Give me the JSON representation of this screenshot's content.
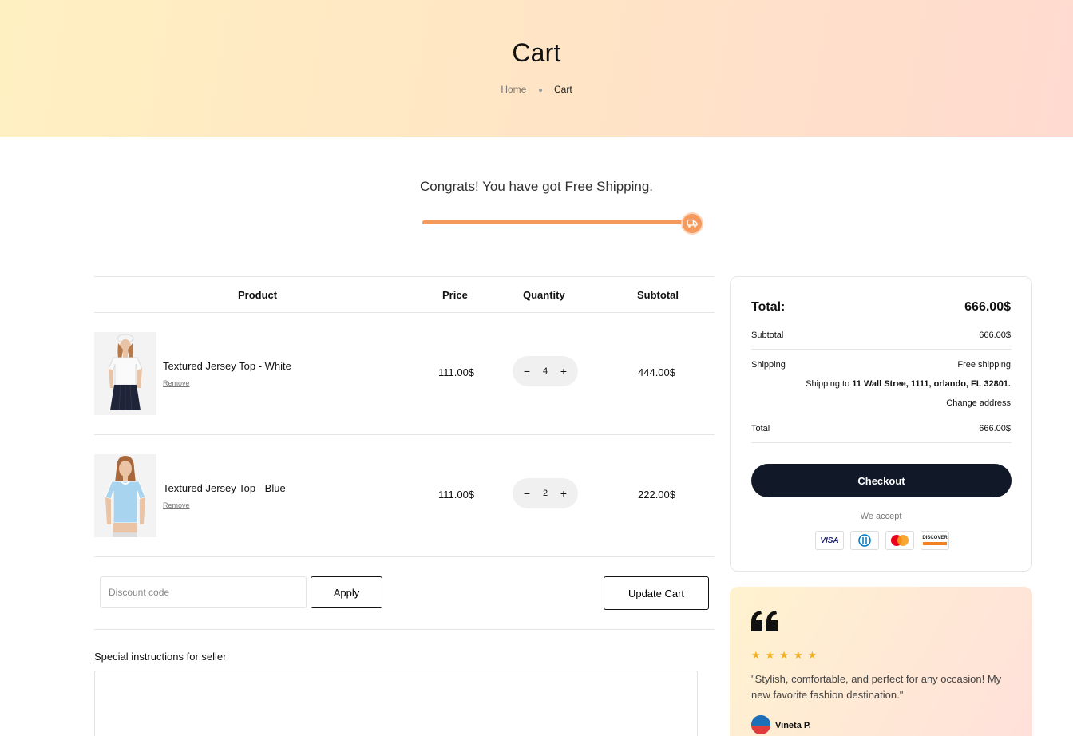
{
  "header": {
    "title": "Cart",
    "breadcrumb": {
      "home": "Home",
      "current": "Cart"
    }
  },
  "shipping_progress": {
    "message": "Congrats! You have got Free Shipping.",
    "percent": 100
  },
  "table": {
    "headers": {
      "product": "Product",
      "price": "Price",
      "quantity": "Quantity",
      "subtotal": "Subtotal"
    },
    "items": [
      {
        "name": "Textured Jersey Top - White",
        "remove_label": "Remove",
        "price": "111.00$",
        "quantity": "4",
        "subtotal": "444.00$",
        "image": "white-top-image"
      },
      {
        "name": "Textured Jersey Top - Blue",
        "remove_label": "Remove",
        "price": "111.00$",
        "quantity": "2",
        "subtotal": "222.00$",
        "image": "blue-top-image"
      }
    ],
    "qty_minus": "−",
    "qty_plus": "+"
  },
  "discount": {
    "placeholder": "Discount code",
    "apply_label": "Apply"
  },
  "update_cart_label": "Update Cart",
  "instructions": {
    "label": "Special instructions for seller"
  },
  "summary": {
    "total_label": "Total:",
    "total_value": "666.00$",
    "subtotal_label": "Subtotal",
    "subtotal_value": "666.00$",
    "shipping_label": "Shipping",
    "shipping_value": "Free shipping",
    "shipping_to_prefix": "Shipping to ",
    "shipping_to_address": "11 Wall Stree, 1111, orlando, FL 32801.",
    "change_address": "Change address",
    "total2_label": "Total",
    "total2_value": "666.00$",
    "checkout_label": "Checkout",
    "we_accept": "We accept",
    "cards": [
      "VISA",
      "Diners",
      "Mastercard",
      "DISCOVER"
    ]
  },
  "testimonial": {
    "rating": 5,
    "stars": "★★★★★",
    "text": "\"Stylish, comfortable, and perfect for any occasion! My new favorite fashion destination.\"",
    "name": "Vineta P."
  },
  "colors": {
    "accent": "#f39a5c",
    "dark": "#111827",
    "star": "#f2b01e"
  }
}
